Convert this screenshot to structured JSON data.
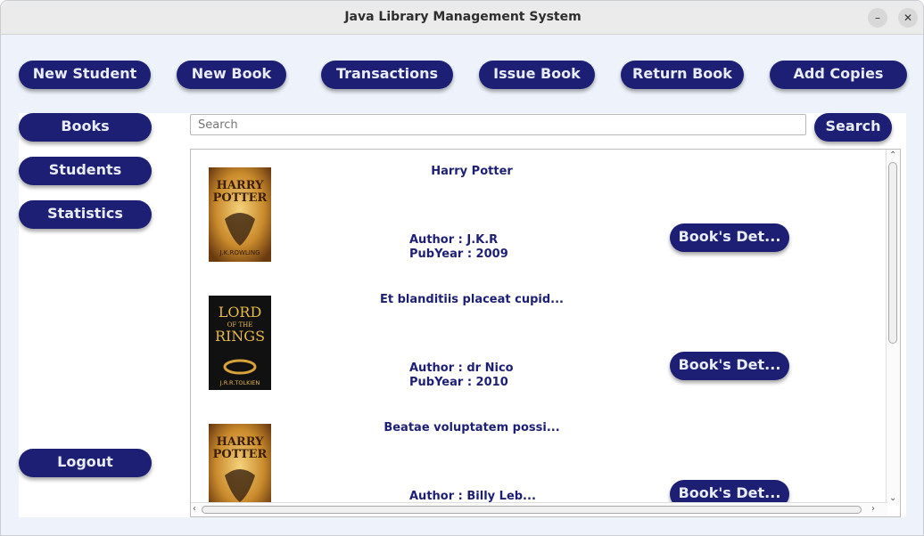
{
  "window": {
    "title": "Java Library Management System"
  },
  "toolbar": {
    "new_student": "New Student",
    "new_book": "New Book",
    "transactions": "Transactions",
    "issue_book": "Issue Book",
    "return_book": "Return Book",
    "add_copies": "Add Copies"
  },
  "sidebar": {
    "books": "Books",
    "students": "Students",
    "statistics": "Statistics",
    "logout": "Logout"
  },
  "search": {
    "placeholder": "Search",
    "button": "Search"
  },
  "books": [
    {
      "title": "Harry Potter",
      "author": "Author : J.K.R",
      "pubyear": "PubYear : 2009",
      "details": "Book's Det...",
      "cover": "harry-potter-cover"
    },
    {
      "title": "Et blanditiis placeat cupid...",
      "author": "Author : dr Nico",
      "pubyear": "PubYear : 2010",
      "details": "Book's Det...",
      "cover": "lord-of-the-rings-cover"
    },
    {
      "title": "Beatae voluptatem possi...",
      "author": "Author : Billy Leb...",
      "pubyear": "",
      "details": "Book's Det...",
      "cover": "harry-potter-cover"
    }
  ],
  "covers": {
    "hp": {
      "line1": "HARRY",
      "line2": "POTTER",
      "author": "J.K.ROWLING"
    },
    "lotr": {
      "line1": "LORD",
      "line2": "OF THE",
      "line3": "RINGS",
      "author": "J.R.R.TOLKIEN"
    }
  },
  "colors": {
    "accent": "#1c1f73",
    "button_text": "#e9ecf7",
    "background": "#eef3fb"
  }
}
